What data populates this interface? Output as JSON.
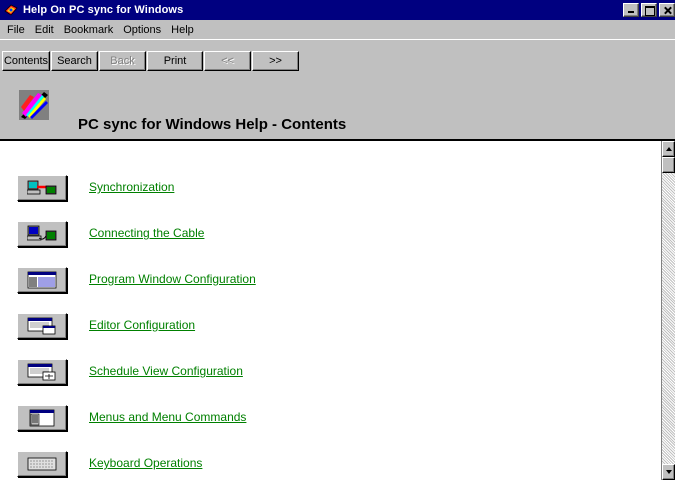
{
  "window": {
    "title": "Help On PC sync for Windows",
    "icon": "help-book-icon"
  },
  "menu": [
    {
      "label": "File"
    },
    {
      "label": "Edit"
    },
    {
      "label": "Bookmark"
    },
    {
      "label": "Options"
    },
    {
      "label": "Help"
    }
  ],
  "toolbar": {
    "contents": "Contents",
    "search": "Search",
    "back": "Back",
    "print": "Print",
    "prev": "<<",
    "next": ">>"
  },
  "header": {
    "title": "PC sync for Windows Help - Contents",
    "icon": "help-contents-book-icon"
  },
  "topics": [
    {
      "label": "Synchronization",
      "icon": "sync-computers-icon"
    },
    {
      "label": "Connecting the Cable",
      "icon": "cable-computer-icon"
    },
    {
      "label": "Program Window Configuration",
      "icon": "program-window-icon"
    },
    {
      "label": "Editor Configuration",
      "icon": "editor-window-icon"
    },
    {
      "label": "Schedule View Configuration",
      "icon": "schedule-window-icon"
    },
    {
      "label": "Menus and Menu Commands",
      "icon": "menu-window-icon"
    },
    {
      "label": "Keyboard Operations",
      "icon": "keyboard-icon"
    }
  ],
  "colors": {
    "titlebar": "#000080",
    "link": "#008000",
    "chrome": "#c0c0c0"
  }
}
